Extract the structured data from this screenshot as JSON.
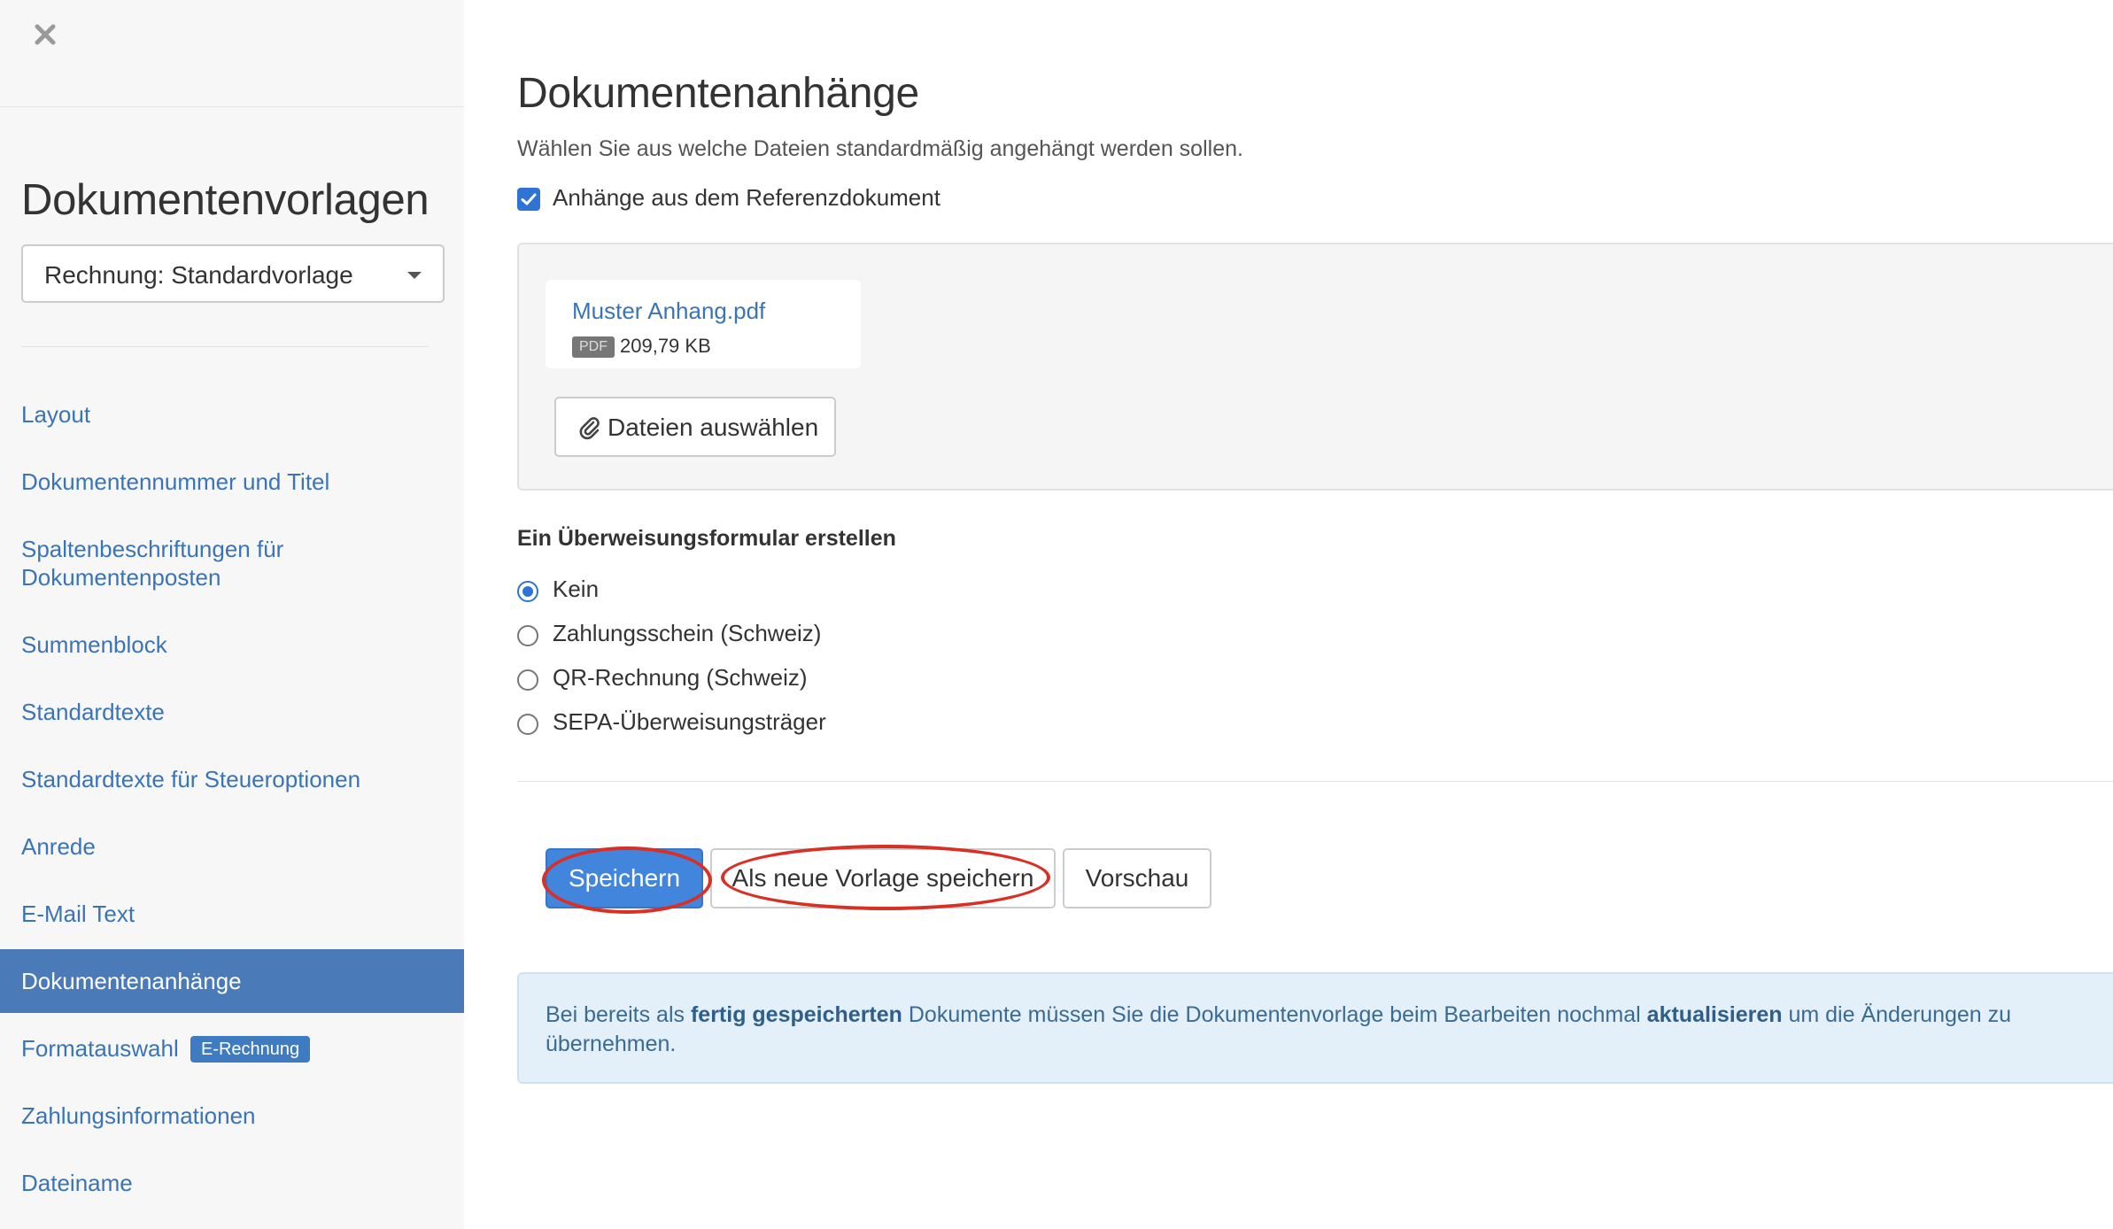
{
  "sidebar": {
    "title": "Dokumentenvorlagen",
    "template_select": {
      "value": "Rechnung: Standardvorlage"
    },
    "nav": [
      {
        "label": "Layout"
      },
      {
        "label": "Dokumentennummer und Titel"
      },
      {
        "label_line1": "Spaltenbeschriftungen für",
        "label_line2": "Dokumentenposten"
      },
      {
        "label": "Summenblock"
      },
      {
        "label": "Standardtexte"
      },
      {
        "label": "Standardtexte für Steueroptionen"
      },
      {
        "label": "Anrede"
      },
      {
        "label": "E-Mail Text"
      },
      {
        "label": "Dokumentenanhänge",
        "active": true
      },
      {
        "label": "Formatauswahl",
        "badge": "E-Rechnung"
      },
      {
        "label": "Zahlungsinformationen"
      },
      {
        "label": "Dateiname"
      }
    ]
  },
  "main": {
    "title": "Dokumentenanhänge",
    "description": "Wählen Sie aus welche Dateien standardmäßig angehängt werden sollen.",
    "reference_checkbox": {
      "label": "Anhänge aus dem Referenzdokument",
      "checked": true
    },
    "attachment": {
      "name": "Muster Anhang.pdf",
      "type": "PDF",
      "size": "209,79 KB"
    },
    "choose_files_label": "Dateien auswählen",
    "transfer_form": {
      "label": "Ein Überweisungsformular erstellen",
      "options": [
        {
          "label": "Kein",
          "checked": true
        },
        {
          "label": "Zahlungsschein (Schweiz)",
          "checked": false
        },
        {
          "label": "QR-Rechnung (Schweiz)",
          "checked": false
        },
        {
          "label": "SEPA-Überweisungsträger",
          "checked": false
        }
      ]
    },
    "buttons": {
      "save": "Speichern",
      "save_as_new": "Als neue Vorlage speichern",
      "preview": "Vorschau"
    },
    "info": {
      "part1": "Bei bereits als ",
      "bold1": "fertig gespeicherten",
      "part2": " Dokumente müssen Sie die Dokumentenvorlage beim Bearbeiten nochmal ",
      "bold2": "aktualisieren",
      "part3": " um die Änderungen zu übernehmen."
    }
  },
  "colors": {
    "accent": "#4285dc",
    "link": "#3a74b6",
    "active_nav": "#4a7ab8",
    "highlight": "#d93025"
  }
}
